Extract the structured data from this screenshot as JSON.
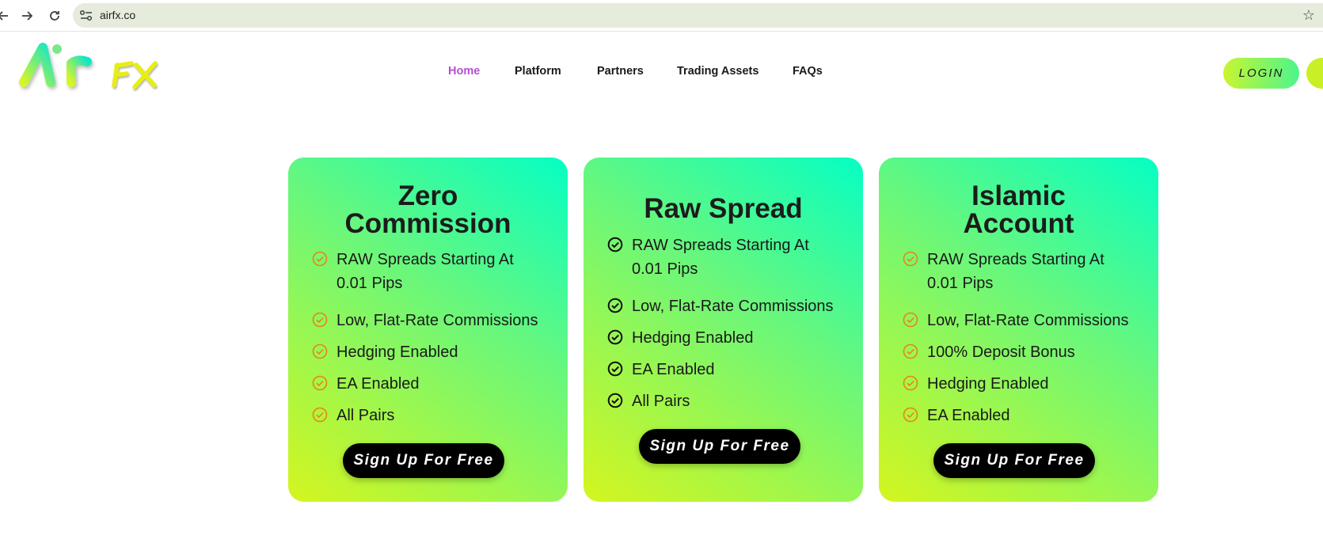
{
  "browser": {
    "url": "airfx.co",
    "back_icon": "back-arrow-icon",
    "forward_icon": "forward-arrow-icon",
    "reload_icon": "reload-icon"
  },
  "logo": {
    "word": "Air",
    "accent": "FX"
  },
  "nav": {
    "items": [
      {
        "label": "Home",
        "active": true
      },
      {
        "label": "Platform"
      },
      {
        "label": "Partners"
      },
      {
        "label": "Trading Assets"
      },
      {
        "label": "FAQs"
      }
    ]
  },
  "header": {
    "login_label": "LOGIN"
  },
  "colors": {
    "active_nav": "#b64fd0",
    "card_gradient_top": "#05ffc4",
    "card_gradient_bottom": "#d4f51f",
    "check_orange": "#e8831a",
    "check_dark": "#111111"
  },
  "cards": [
    {
      "title_line1": "Zero",
      "title_line2": "Commission",
      "features": [
        "RAW Spreads Starting At",
        "0.01 Pips",
        "Low, Flat-Rate Commissions",
        "Hedging Enabled",
        "EA Enabled",
        "All Pairs"
      ],
      "button": "Sign Up For Free"
    },
    {
      "title_line1": "Raw Spread",
      "features": [
        "RAW Spreads Starting At",
        "0.01 Pips",
        "Low, Flat-Rate Commissions",
        "Hedging Enabled",
        "EA Enabled",
        "All Pairs"
      ],
      "button": "Sign Up For Free"
    },
    {
      "title_line1": "Islamic",
      "title_line2": "Account",
      "features": [
        "RAW Spreads Starting At",
        "0.01 Pips",
        "Low, Flat-Rate Commissions",
        "100% Deposit Bonus",
        "Hedging Enabled",
        "EA Enabled"
      ],
      "button": "Sign Up For Free"
    }
  ]
}
